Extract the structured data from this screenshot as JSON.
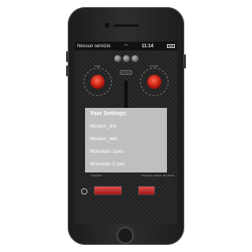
{
  "status_bar": {
    "carrier": "Nessun servizio",
    "time": "11:14"
  },
  "app": {
    "knob_labels": [
      "TIME",
      "ROOM"
    ],
    "bottom_labels": [
      "FREEZE",
      "STEREO INDEP. REVERB"
    ]
  },
  "dialog": {
    "title": "Your Settings:",
    "items": [
      "Misano_dry",
      "Misano_wet",
      "Mountain 1pax",
      "Mountain 2 pax"
    ]
  },
  "colors": {
    "dialog_bg": "#bfbfbf",
    "accent_red": "#c01a10"
  }
}
